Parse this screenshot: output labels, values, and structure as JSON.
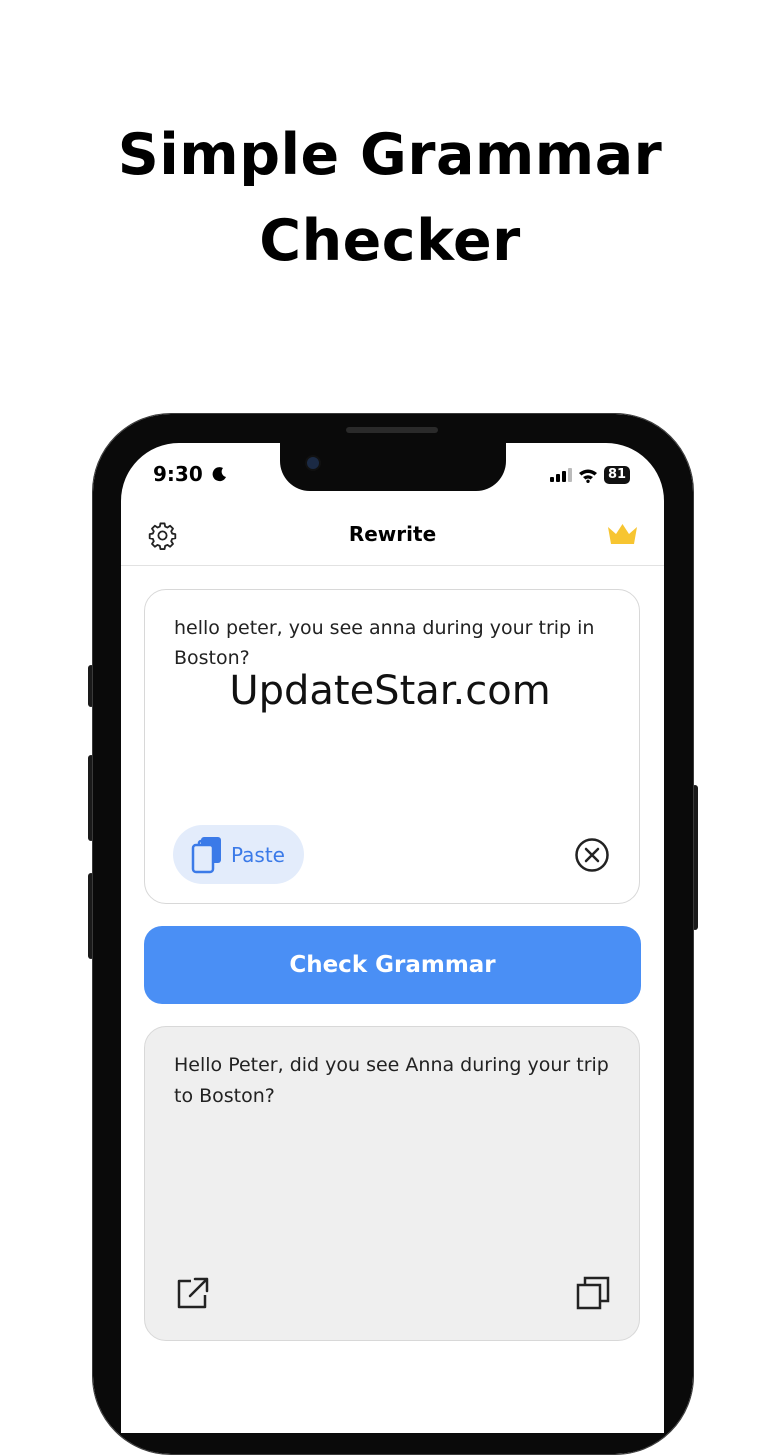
{
  "headline": {
    "line1": "Simple Grammar",
    "line2": "Checker"
  },
  "status_bar": {
    "time": "9:30",
    "battery": "81"
  },
  "nav": {
    "title": "Rewrite",
    "left_icon": "gear-icon",
    "right_icon": "crown-icon"
  },
  "input": {
    "text": "hello peter, you see anna during your trip in Boston?",
    "paste_label": "Paste"
  },
  "check_button": {
    "label": "Check Grammar"
  },
  "output": {
    "text": "Hello Peter, did you see Anna during your trip to Boston?"
  },
  "watermark": "UpdateStar.com",
  "colors": {
    "accent": "#4a8ff5",
    "paste_bg": "#e3ecfb",
    "crown": "#f7c531",
    "output_bg": "#efefef"
  }
}
